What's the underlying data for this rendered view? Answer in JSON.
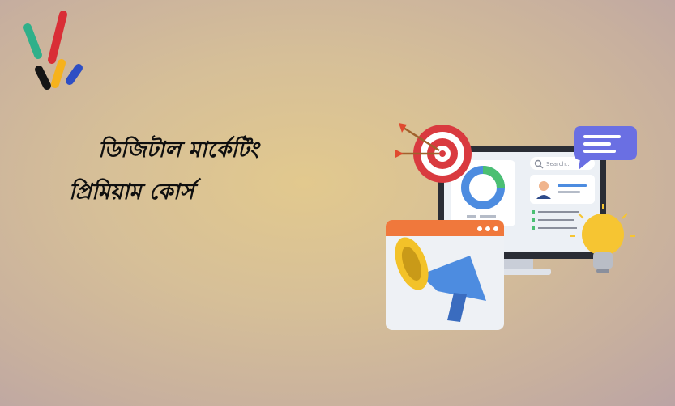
{
  "headline": {
    "line1": "ডিজিটাল মার্কেটিং",
    "line2": "প্রিমিয়াম কোর্স"
  },
  "illustration": {
    "search_placeholder": "Search...",
    "icons": [
      "target-icon",
      "monitor-icon",
      "chat-bubble-icon",
      "megaphone-icon",
      "lightbulb-icon",
      "pie-chart-icon",
      "user-card-icon",
      "checklist-icon"
    ]
  },
  "colors": {
    "logo_green": "#2fb08a",
    "logo_red": "#d92e36",
    "logo_black": "#151515",
    "logo_yellow": "#f6b21c",
    "logo_blue": "#2d4ec4",
    "target_red": "#d93a3f",
    "megaphone_yellow": "#f3c229",
    "accent_blue": "#4d8ce0",
    "chat_purple": "#6a6fe3"
  }
}
